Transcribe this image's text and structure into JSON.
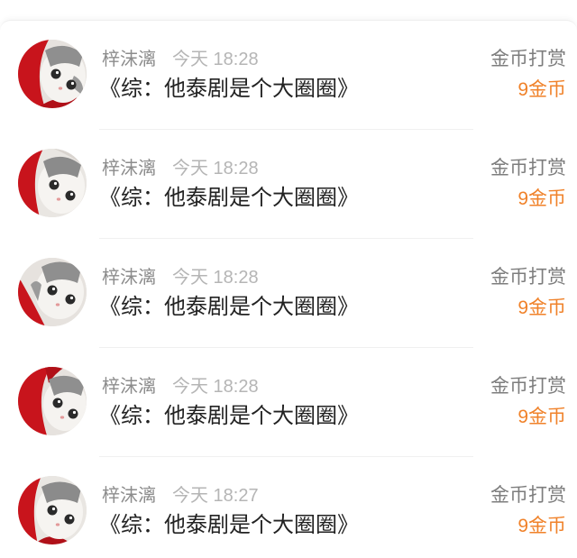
{
  "records": [
    {
      "user": "梓沫漓",
      "time": "今天 18:28",
      "book": "《综：他泰剧是个大圈圈》",
      "reward_type": "金币打赏",
      "amount": "9金币"
    },
    {
      "user": "梓沫漓",
      "time": "今天 18:28",
      "book": "《综：他泰剧是个大圈圈》",
      "reward_type": "金币打赏",
      "amount": "9金币"
    },
    {
      "user": "梓沫漓",
      "time": "今天 18:28",
      "book": "《综：他泰剧是个大圈圈》",
      "reward_type": "金币打赏",
      "amount": "9金币"
    },
    {
      "user": "梓沫漓",
      "time": "今天 18:28",
      "book": "《综：他泰剧是个大圈圈》",
      "reward_type": "金币打赏",
      "amount": "9金币"
    },
    {
      "user": "梓沫漓",
      "time": "今天 18:27",
      "book": "《综：他泰剧是个大圈圈》",
      "reward_type": "金币打赏",
      "amount": "9金币"
    }
  ],
  "icons": {
    "avatar": "cat-avatar-icon"
  },
  "colors": {
    "accent": "#f0822a",
    "text": "#222222",
    "muted": "#8c8c8c",
    "time": "#b5b5b5",
    "divider": "#f0f0f0"
  }
}
